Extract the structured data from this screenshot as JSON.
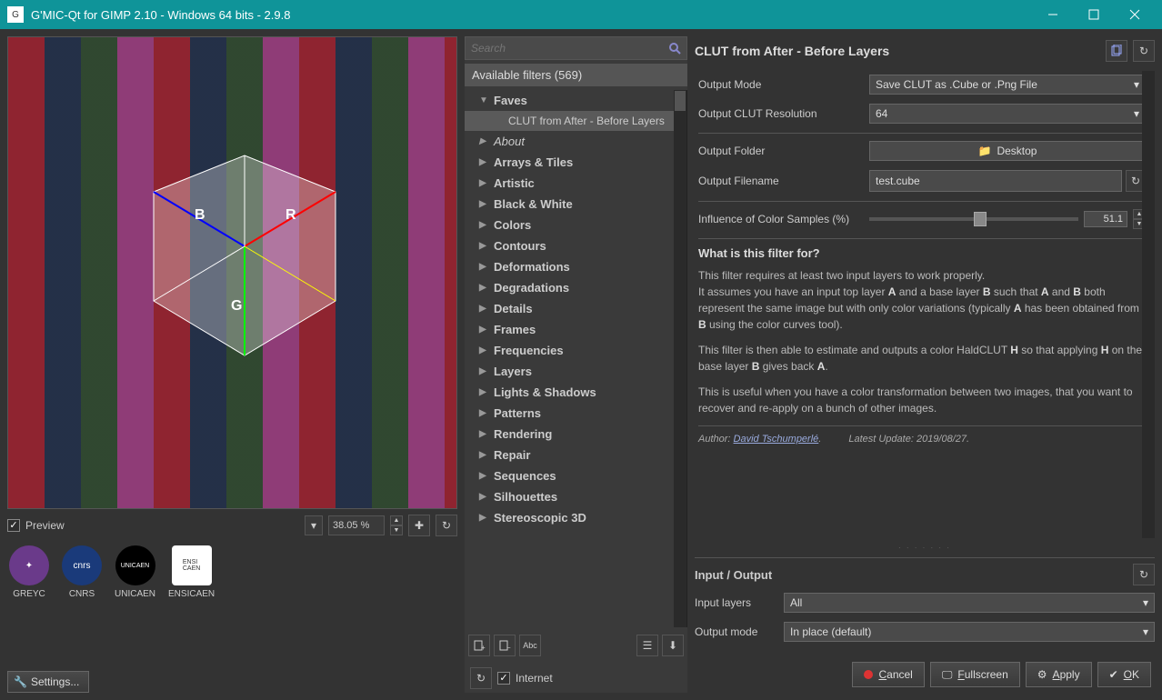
{
  "window": {
    "title": "G'MIC-Qt for GIMP 2.10 - Windows 64 bits - 2.9.8"
  },
  "preview": {
    "checkbox_label": "Preview",
    "zoom": "38.05 %"
  },
  "logos": {
    "greyc": "GREYC",
    "cnrs": "CNRS",
    "unicaen": "UNICAEN",
    "ensicaen": "ENSICAEN"
  },
  "settings_button": "Settings...",
  "search": {
    "placeholder": "Search"
  },
  "filters_header": "Available filters (569)",
  "tree": {
    "faves": "Faves",
    "faves_child": "CLUT from After - Before Layers",
    "about": "About",
    "categories": [
      "Arrays & Tiles",
      "Artistic",
      "Black & White",
      "Colors",
      "Contours",
      "Deformations",
      "Degradations",
      "Details",
      "Frames",
      "Frequencies",
      "Layers",
      "Lights & Shadows",
      "Patterns",
      "Rendering",
      "Repair",
      "Sequences",
      "Silhouettes",
      "Stereoscopic 3D"
    ]
  },
  "internet_label": "Internet",
  "filter": {
    "title": "CLUT from After - Before Layers",
    "output_mode_label": "Output Mode",
    "output_mode_value": "Save CLUT as .Cube or .Png File",
    "clut_resolution_label": "Output CLUT Resolution",
    "clut_resolution_value": "64",
    "output_folder_label": "Output Folder",
    "output_folder_value": "Desktop",
    "output_filename_label": "Output Filename",
    "output_filename_value": "test.cube",
    "influence_label": "Influence of Color Samples (%)",
    "influence_value": "51.1",
    "section_title": "What is this filter for?",
    "p1_a": "This filter requires at least two input layers to work properly.",
    "p1_b": "It assumes you have an input top layer ",
    "p1_c": " and a base layer ",
    "p1_d": " such that ",
    "p1_e": " and ",
    "p1_f": " both represent the same image but with only color variations (typically ",
    "p1_g": " has been obtained from ",
    "p1_h": " using the color curves tool).",
    "p2_a": "This filter is then able to estimate and outputs a color HaldCLUT ",
    "p2_b": " so that applying ",
    "p2_c": " on the base layer ",
    "p2_d": " gives back ",
    "p2_e": ".",
    "p3": "This is useful when you have a color transformation between two images, that you want to recover and re-apply on a bunch of other images.",
    "author_label": "Author: ",
    "author_name": "David Tschumperlé",
    "author_dot": ".",
    "update_label": "Latest Update: ",
    "update_value": "2019/08/27",
    "update_dot": "."
  },
  "io": {
    "title": "Input / Output",
    "input_layers_label": "Input layers",
    "input_layers_value": "All",
    "output_mode_label": "Output mode",
    "output_mode_value": "In place (default)"
  },
  "buttons": {
    "cancel": "Cancel",
    "fullscreen": "Fullscreen",
    "apply": "Apply",
    "ok": "OK"
  }
}
